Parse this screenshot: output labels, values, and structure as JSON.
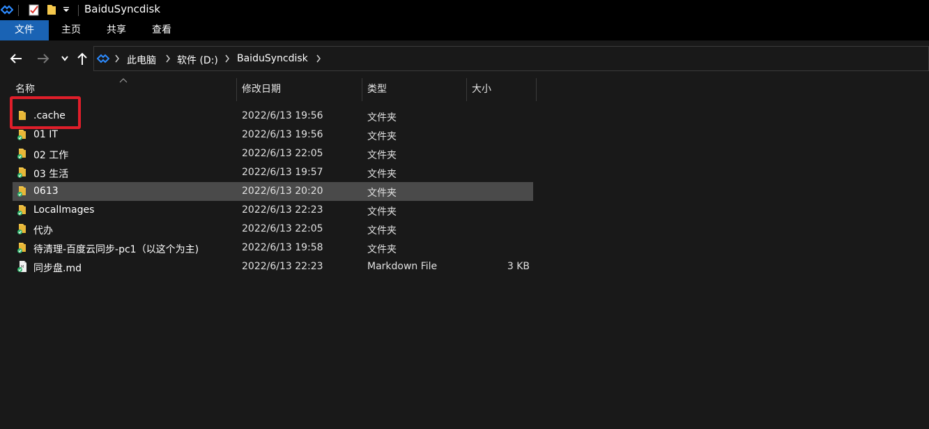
{
  "window": {
    "title": "BaiduSyncdisk"
  },
  "ribbon": {
    "tabs": [
      "文件",
      "主页",
      "共享",
      "查看"
    ]
  },
  "breadcrumb": [
    "此电脑",
    "软件 (D:)",
    "BaiduSyncdisk"
  ],
  "columns": {
    "name": "名称",
    "modified": "修改日期",
    "type": "类型",
    "size": "大小"
  },
  "files": [
    {
      "name": ".cache",
      "modified": "2022/6/13 19:56",
      "type": "文件夹",
      "size": "",
      "icon": "folder-icon"
    },
    {
      "name": "01 IT",
      "modified": "2022/6/13 19:56",
      "type": "文件夹",
      "size": "",
      "icon": "synced-folder-icon"
    },
    {
      "name": "02 工作",
      "modified": "2022/6/13 22:05",
      "type": "文件夹",
      "size": "",
      "icon": "synced-folder-icon"
    },
    {
      "name": "03 生活",
      "modified": "2022/6/13 19:57",
      "type": "文件夹",
      "size": "",
      "icon": "synced-folder-icon"
    },
    {
      "name": "0613",
      "modified": "2022/6/13 20:20",
      "type": "文件夹",
      "size": "",
      "icon": "synced-folder-icon",
      "selected": true
    },
    {
      "name": "LocalImages",
      "modified": "2022/6/13 22:23",
      "type": "文件夹",
      "size": "",
      "icon": "synced-folder-icon"
    },
    {
      "name": "代办",
      "modified": "2022/6/13 22:05",
      "type": "文件夹",
      "size": "",
      "icon": "synced-folder-icon"
    },
    {
      "name": "待清理-百度云同步-pc1（以这个为主)",
      "modified": "2022/6/13 19:58",
      "type": "文件夹",
      "size": "",
      "icon": "synced-folder-icon"
    },
    {
      "name": "同步盘.md",
      "modified": "2022/6/13 22:23",
      "type": "Markdown File",
      "size": "3 KB",
      "icon": "synced-markdown-file-icon"
    }
  ],
  "colors": {
    "accent_tab": "#1a63b4",
    "highlight": "#e01e2a",
    "folder": "#f5c84c",
    "sync_badge": "#2fb36b"
  }
}
